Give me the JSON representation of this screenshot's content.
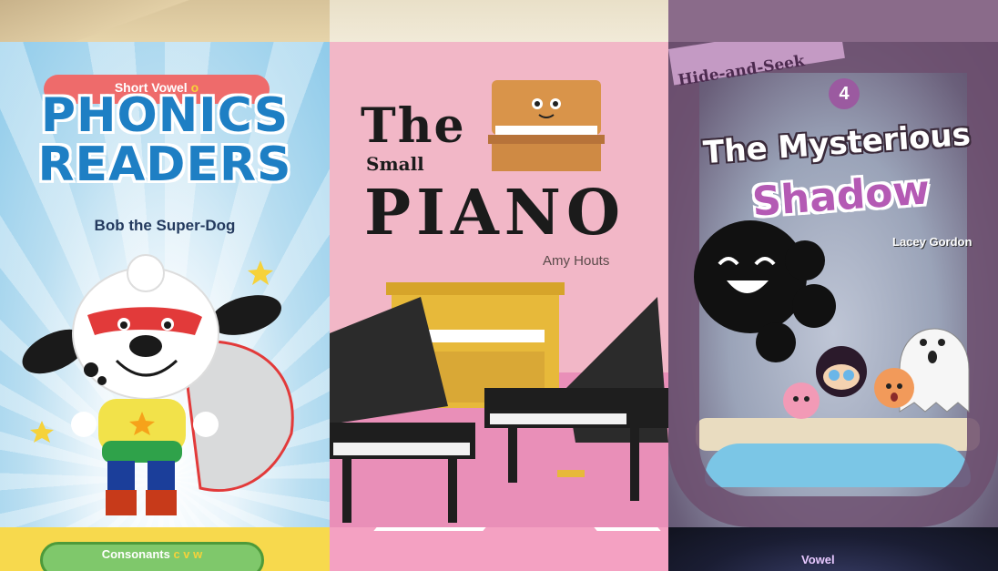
{
  "covers": [
    {
      "series_label": "Short Vowel",
      "series_suffix": "o",
      "title_line1": "PHONICS",
      "title_line2": "READERS",
      "book_title": "Bob the Super-Dog",
      "bottom_label": "Consonants",
      "bottom_suffix": "c v w"
    },
    {
      "title_word1": "The",
      "title_word2": "Small",
      "title_word3": "PIANO",
      "author": "Amy Houts"
    },
    {
      "series_label": "Hide-and-Seek",
      "number": "4",
      "title_line1": "The Mysterious",
      "title_line2": "Shadow",
      "author": "Lacey Gordon",
      "bottom_label": "Vowel"
    }
  ],
  "colors": {
    "phonics_blue": "#1e7fc4",
    "pill_red": "#ee6b6b",
    "piano_pink": "#f2b7c7",
    "shadow_purple": "#b45ab4"
  }
}
